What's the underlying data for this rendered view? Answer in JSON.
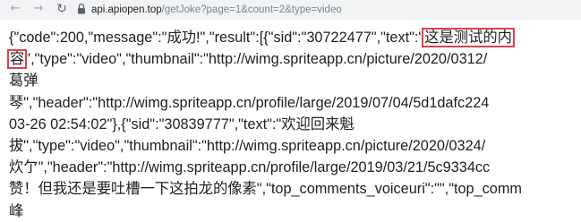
{
  "browser": {
    "back_icon": "←",
    "forward_icon": "→",
    "reload_icon": "↻",
    "url_host": "api.apiopen.top",
    "url_path": "/getJoke?page=1&count=2&type=video"
  },
  "json_lines": [
    {
      "text": "{\"code\":200,\"message\":\"成功!\",\"result\":[{\"sid\":\"30722477\",\"text\":\"",
      "highlight": "这是测试的内"
    },
    {
      "highlight": "容",
      "text": "\",\"type\":\"video\",\"thumbnail\":\"http://wimg.spriteapp.cn/picture/2020/0312/"
    },
    {
      "text": "葛弹"
    },
    {
      "text": "琴\",\"header\":\"http://wimg.spriteapp.cn/profile/large/2019/07/04/5d1dafc224"
    },
    {
      "text": "03-26 02:54:02\"},{\"sid\":\"30839777\",\"text\":\"欢迎回来魁"
    },
    {
      "text": "拔\",\"type\":\"video\",\"thumbnail\":\"http://wimg.spriteapp.cn/picture/2020/0324/"
    },
    {
      "text": "炊亇\",\"header\":\"http://wimg.spriteapp.cn/profile/large/2019/03/21/5c9334cc"
    },
    {
      "text": "赞！但我还是要吐槽一下这拍龙的像素\",\"top_comments_voiceuri\":\"\",\"top_comm"
    },
    {
      "text": "峰"
    }
  ]
}
